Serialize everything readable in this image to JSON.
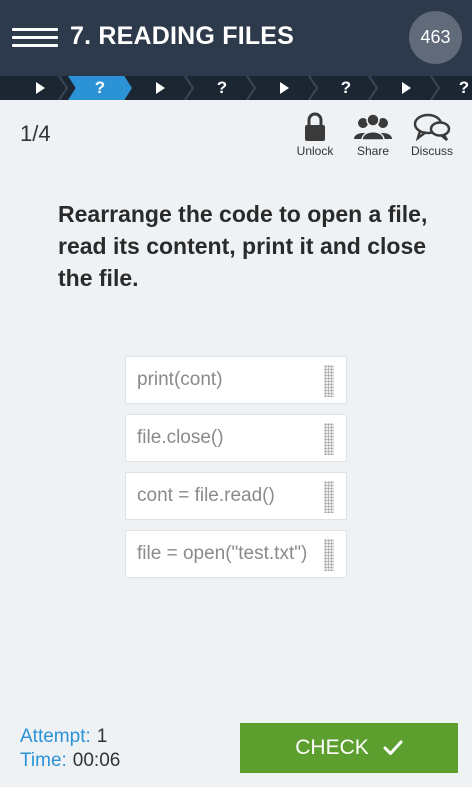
{
  "header": {
    "title": "7. READING FILES",
    "xp": "463"
  },
  "progress": {
    "steps": [
      {
        "type": "arrow",
        "label": ""
      },
      {
        "type": "quiz",
        "label": "?",
        "active": true
      },
      {
        "type": "arrow",
        "label": ""
      },
      {
        "type": "quiz",
        "label": "?"
      },
      {
        "type": "arrow",
        "label": ""
      },
      {
        "type": "quiz",
        "label": "?"
      },
      {
        "type": "arrow",
        "label": ""
      },
      {
        "type": "quiz",
        "label": "?"
      }
    ],
    "active_color": "#2c92d6"
  },
  "counter": "1/4",
  "actions": {
    "unlock": "Unlock",
    "share": "Share",
    "discuss": "Discuss"
  },
  "question": "Rearrange the code to open a file, read its content, print it and close the file.",
  "code_blocks": [
    "print(cont)",
    "file.close()",
    "cont = file.read()",
    "file = open(\"test.txt\")"
  ],
  "footer": {
    "attempt_label": "Attempt:",
    "attempt_value": "1",
    "time_label": "Time:",
    "time_value": "00:06",
    "check_label": "CHECK",
    "check_color": "#5c9f2f"
  }
}
